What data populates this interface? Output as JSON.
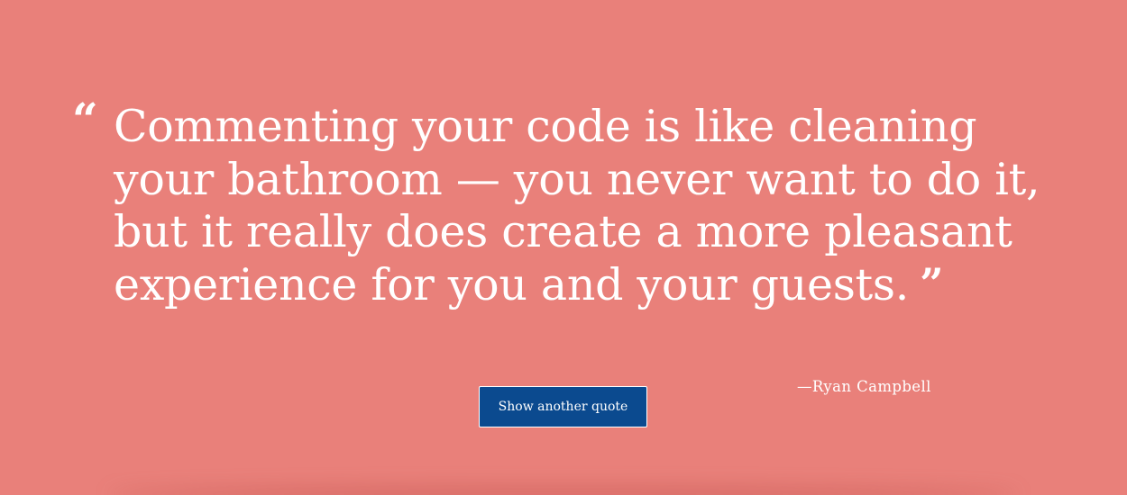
{
  "quote": {
    "open_mark": "“",
    "text": "Commenting your code is like cleaning your bathroom — you never want to do it, but it really does create a more pleasant experience for you and your guests.",
    "close_mark": "”",
    "author": "—Ryan Campbell"
  },
  "controls": {
    "new_quote_label": "Show another quote"
  },
  "colors": {
    "background": "#e9807a",
    "text": "#ffffff",
    "button": "#0b4a8f"
  }
}
